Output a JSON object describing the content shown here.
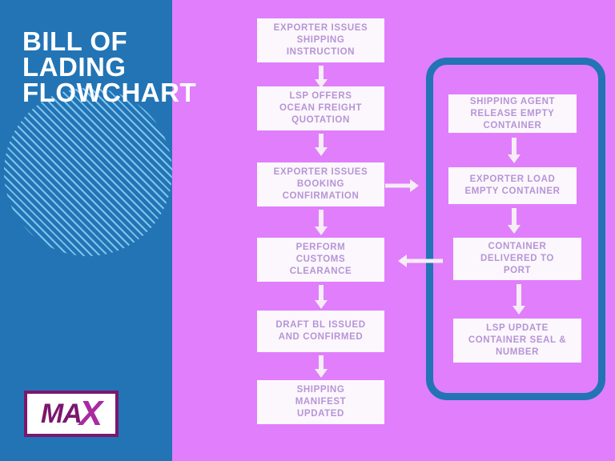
{
  "title": "BILL OF\nLADING\nFLOWCHART",
  "colors": {
    "panel_blue": "#2274B5",
    "background_magenta": "#E07EFC",
    "box_fill": "#FBF7FC",
    "box_text": "#B794D6",
    "arrow": "#F6EDF6",
    "logo_dark_purple": "#7B176E",
    "logo_bright_purple": "#A82BA0",
    "stripe_light_blue": "#7FC4EC"
  },
  "logo": {
    "prefix": "MA",
    "accent": "X"
  },
  "main_flow": [
    {
      "id": "step-1",
      "label": "EXPORTER ISSUES\nSHIPPING\nINSTRUCTION"
    },
    {
      "id": "step-2",
      "label": "LSP OFFERS\nOCEAN FREIGHT\nQUOTATION"
    },
    {
      "id": "step-3",
      "label": "EXPORTER ISSUES\nBOOKING\nCONFIRMATION"
    },
    {
      "id": "step-4",
      "label": "PERFORM\nCUSTOMS\nCLEARANCE"
    },
    {
      "id": "step-5",
      "label": "DRAFT BL ISSUED\nAND CONFIRMED"
    },
    {
      "id": "step-6",
      "label": "SHIPPING\nMANIFEST\nUPDATED"
    }
  ],
  "container_flow": [
    {
      "id": "cstep-1",
      "label": "SHIPPING AGENT\nRELEASE EMPTY\nCONTAINER"
    },
    {
      "id": "cstep-2",
      "label": "EXPORTER LOAD\nEMPTY CONTAINER"
    },
    {
      "id": "cstep-3",
      "label": "CONTAINER\nDELIVERED TO\nPORT"
    },
    {
      "id": "cstep-4",
      "label": "LSP UPDATE\nCONTAINER SEAL &\nNUMBER"
    }
  ]
}
